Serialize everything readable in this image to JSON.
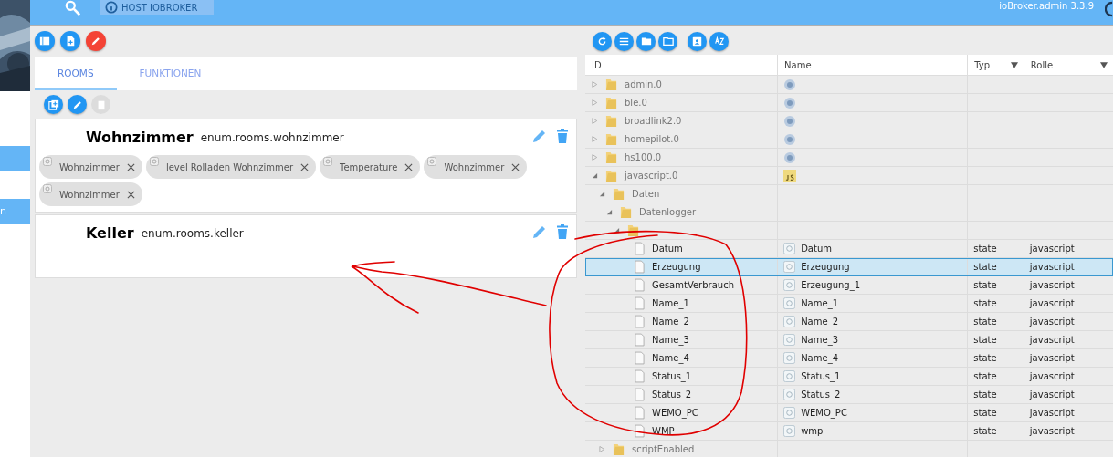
{
  "topbar": {
    "host_button": "HOST IOBROKER",
    "version": "ioBroker.admin 3.3.9"
  },
  "sidebar": {
    "items": [
      {
        "kind": "blank"
      },
      {
        "kind": "text",
        "label": "n"
      }
    ]
  },
  "enums": {
    "tabs": [
      {
        "label": "ROOMS",
        "selected": true
      },
      {
        "label": "FUNKTIONEN",
        "selected": false
      }
    ],
    "cards": [
      {
        "title": "Wohnzimmer",
        "id": "enum.rooms.wohnzimmer",
        "members": [
          "Wohnzimmer",
          "level Rolladen Wohnzimmer",
          "Temperature",
          "Wohnzimmer",
          "Wohnzimmer"
        ]
      },
      {
        "title": "Keller",
        "id": "enum.rooms.keller"
      }
    ]
  },
  "objects": {
    "columns": [
      {
        "label": "ID",
        "filter": false
      },
      {
        "label": "Name",
        "filter": false
      },
      {
        "label": "Typ",
        "filter": true
      },
      {
        "label": "Rolle",
        "filter": true
      }
    ],
    "tree": [
      {
        "id": "admin.0",
        "kind": "adapter",
        "expanded": false
      },
      {
        "id": "ble.0",
        "kind": "adapter",
        "expanded": false
      },
      {
        "id": "broadlink2.0",
        "kind": "adapter",
        "expanded": false
      },
      {
        "id": "homepilot.0",
        "kind": "adapter",
        "expanded": false
      },
      {
        "id": "hs100.0",
        "kind": "adapter",
        "expanded": false
      },
      {
        "id": "javascript.0",
        "kind": "adapter-js",
        "expanded": true,
        "children": [
          {
            "id": "Daten",
            "kind": "folder",
            "expanded": true,
            "children": [
              {
                "id": "Datenlogger",
                "kind": "folder",
                "expanded": true,
                "children": [
                  {
                    "kind": "folder",
                    "expanded": true,
                    "children": [
                      {
                        "id": "Datum",
                        "kind": "state",
                        "name": "Datum",
                        "type": "state",
                        "role": "javascript",
                        "selected": false
                      },
                      {
                        "id": "Erzeugung",
                        "kind": "state",
                        "name": "Erzeugung",
                        "type": "state",
                        "role": "javascript",
                        "selected": true
                      },
                      {
                        "id": "GesamtVerbrauch",
                        "kind": "state",
                        "name": "Erzeugung_1",
                        "type": "state",
                        "role": "javascript",
                        "selected": false
                      },
                      {
                        "id": "Name_1",
                        "kind": "state",
                        "name": "Name_1",
                        "type": "state",
                        "role": "javascript",
                        "selected": false
                      },
                      {
                        "id": "Name_2",
                        "kind": "state",
                        "name": "Name_2",
                        "type": "state",
                        "role": "javascript",
                        "selected": false
                      },
                      {
                        "id": "Name_3",
                        "kind": "state",
                        "name": "Name_3",
                        "type": "state",
                        "role": "javascript",
                        "selected": false
                      },
                      {
                        "id": "Name_4",
                        "kind": "state",
                        "name": "Name_4",
                        "type": "state",
                        "role": "javascript",
                        "selected": false
                      },
                      {
                        "id": "Status_1",
                        "kind": "state",
                        "name": "Status_1",
                        "type": "state",
                        "role": "javascript",
                        "selected": false
                      },
                      {
                        "id": "Status_2",
                        "kind": "state",
                        "name": "Status_2",
                        "type": "state",
                        "role": "javascript",
                        "selected": false
                      },
                      {
                        "id": "WEMO_PC",
                        "kind": "state",
                        "name": "WEMO_PC",
                        "type": "state",
                        "role": "javascript",
                        "selected": false
                      },
                      {
                        "id": "WMP",
                        "kind": "state",
                        "name": "wmp",
                        "type": "state",
                        "role": "javascript",
                        "selected": false
                      }
                    ]
                  }
                ]
              }
            ]
          },
          {
            "id": "scriptEnabled",
            "kind": "folder",
            "expanded": false
          }
        ]
      }
    ]
  }
}
